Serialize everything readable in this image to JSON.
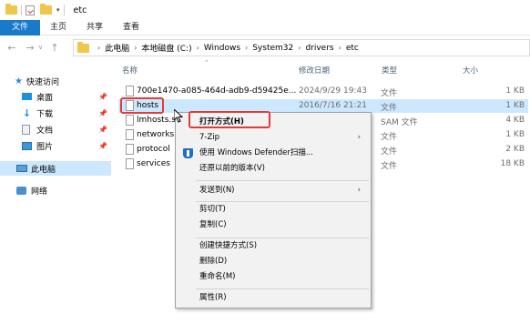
{
  "window": {
    "title": "etc"
  },
  "ribbon": {
    "tabs": [
      "文件",
      "主页",
      "共享",
      "查看"
    ]
  },
  "address": {
    "crumbs": [
      "此电脑",
      "本地磁盘 (C:)",
      "Windows",
      "System32",
      "drivers",
      "etc"
    ]
  },
  "nav": {
    "quick_access": "快速访问",
    "items": [
      {
        "label": "桌面",
        "icon": "desktop-icon",
        "color": "#1b8fe0"
      },
      {
        "label": "下载",
        "icon": "download-icon",
        "color": "#1b8fe0"
      },
      {
        "label": "文档",
        "icon": "documents-icon",
        "color": "#8a99b0"
      },
      {
        "label": "图片",
        "icon": "pictures-icon",
        "color": "#3a9ad9"
      }
    ],
    "this_pc": "此电脑",
    "network": "网络"
  },
  "columns": {
    "name": "名称",
    "date": "修改日期",
    "type": "类型",
    "size": "大小"
  },
  "files": [
    {
      "name": "700e1470-a085-464d-adb9-d59425e...",
      "date": "2024/9/29 19:43",
      "type": "文件",
      "size": "1 KB"
    },
    {
      "name": "hosts",
      "date": "2016/7/16 21:21",
      "type": "文件",
      "size": "1 KB"
    },
    {
      "name": "lmhosts.sam",
      "date": "",
      "type": "SAM 文件",
      "size": "4 KB"
    },
    {
      "name": "networks",
      "date": "",
      "type": "文件",
      "size": "1 KB"
    },
    {
      "name": "protocol",
      "date": "",
      "type": "文件",
      "size": "2 KB"
    },
    {
      "name": "services",
      "date": "",
      "type": "文件",
      "size": "18 KB"
    }
  ],
  "context_menu": {
    "open_with": "打开方式(H)",
    "zip": "7-Zip",
    "defender": "使用 Windows Defender扫描...",
    "restore": "还原以前的版本(V)",
    "send_to": "发送到(N)",
    "cut": "剪切(T)",
    "copy": "复制(C)",
    "shortcut": "创建快捷方式(S)",
    "delete": "删除(D)",
    "rename": "重命名(M)",
    "properties": "属性(R)"
  },
  "colors": {
    "accent": "#1979ca",
    "selection": "#cce8ff",
    "highlight": "#e23b3b"
  }
}
